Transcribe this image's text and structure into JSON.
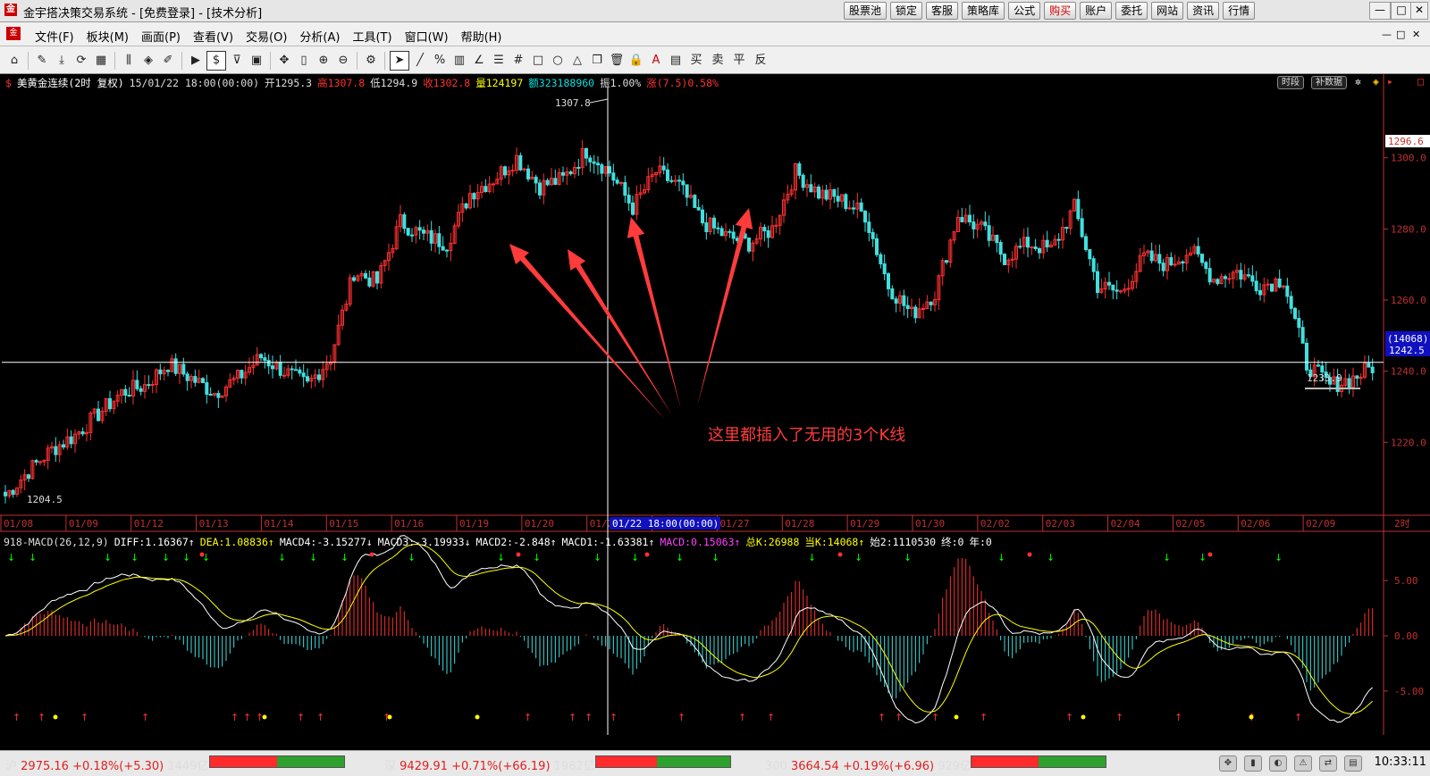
{
  "window": {
    "title": "金宇搭决策交易系统 - [免费登录] - [技术分析]",
    "top_buttons": [
      "股票池",
      "锁定",
      "客服",
      "策略库",
      "公式",
      "购买",
      "账户",
      "委托",
      "网站",
      "资讯",
      "行情"
    ],
    "controls": [
      "—",
      "□",
      "✕"
    ]
  },
  "menu": {
    "items": [
      "文件(F)",
      "板块(M)",
      "画面(P)",
      "查看(V)",
      "交易(O)",
      "分析(A)",
      "工具(T)",
      "窗口(W)",
      "帮助(H)"
    ],
    "mdi_controls": [
      "—",
      "□",
      "✕"
    ]
  },
  "toolbar": {
    "icons": [
      "home-icon",
      "pencil-icon",
      "download-icon",
      "refresh-icon",
      "grid-icon",
      "candles-icon",
      "diamond-icon",
      "edit-icon",
      "play-icon",
      "dollar-icon",
      "filter-icon",
      "calendar-icon",
      "move-icon",
      "bar-icon",
      "zoom-in-icon",
      "zoom-out-icon",
      "gear-icon",
      "pointer-icon",
      "line-tool-icon",
      "percent-icon",
      "ruler-icon",
      "angle-icon",
      "lines-icon",
      "hash-icon",
      "rect-icon",
      "circle-icon",
      "triangle-icon",
      "copy-icon",
      "trash-icon",
      "lock-icon",
      "text-color-icon",
      "box-icon"
    ],
    "text_tools": [
      "买",
      "卖",
      "平",
      "反"
    ]
  },
  "main_chart": {
    "symbol": "美黄金连续(2时 复权)",
    "datetime": "15/01/22 18:00(00:00)",
    "open": "开1295.3",
    "high": "高1307.8",
    "low": "低1294.9",
    "close": "收1302.8",
    "volume": "量124197",
    "amount": "额323188960",
    "amplitude": "振1.00%",
    "change": "涨(7.5)0.58%",
    "buttons": [
      "时段",
      "补数据"
    ],
    "high_label": "1307.8",
    "low_label": "1204.5",
    "last_label": "1233.9",
    "annotation": "这里都插入了无用的3个K线",
    "y_ticks": [
      "1300.0",
      "1280.0",
      "1260.0",
      "1240.0",
      "1220.0"
    ],
    "price_tag": "1296.6",
    "cursor_tag_top": "(14068)",
    "cursor_tag": "1242.5",
    "x_dates": [
      "01/08",
      "01/09",
      "01/12",
      "01/13",
      "01/14",
      "01/15",
      "01/16",
      "01/19",
      "01/20",
      "01/21",
      "01/22",
      "01/27",
      "01/28",
      "01/29",
      "01/30",
      "02/02",
      "02/03",
      "02/04",
      "02/05",
      "02/06",
      "02/09"
    ],
    "cursor_date": "01/22 18:00(00:00)",
    "period": "2时"
  },
  "indicator": {
    "name": "918-MACD(26,12,9)",
    "values": [
      "DIFF:1.16367↑",
      "DEA:1.08836↑",
      "MACD4:-3.15277↓",
      "MACD3:-3.19933↓",
      "MACD2:-2.848↑",
      "MACD1:-1.63381↑",
      "MACD:0.15063↑",
      "总K:26988",
      "当K:14068↑",
      "始2:1110530",
      "终:0",
      "年:0"
    ],
    "y_ticks": [
      "5.00",
      "0.00",
      "-5.00"
    ]
  },
  "chart_data": {
    "type": "candlestick",
    "title": "美黄金连续(2时 复权)",
    "ylim": [
      1200,
      1320
    ],
    "categories": [
      "01/08",
      "01/09",
      "01/12",
      "01/13",
      "01/14",
      "01/15",
      "01/16",
      "01/19",
      "01/20",
      "01/21",
      "01/22",
      "01/27",
      "01/28",
      "01/29",
      "01/30",
      "02/02",
      "02/03",
      "02/04",
      "02/05",
      "02/06",
      "02/09"
    ],
    "close_path": [
      1205,
      1212,
      1218,
      1222,
      1228,
      1234,
      1236,
      1242,
      1238,
      1234,
      1238,
      1244,
      1240,
      1236,
      1244,
      1268,
      1265,
      1282,
      1278,
      1276,
      1290,
      1294,
      1300,
      1292,
      1294,
      1302,
      1296,
      1286,
      1296,
      1292,
      1282,
      1278,
      1276,
      1280,
      1296,
      1290,
      1288,
      1284,
      1264,
      1256,
      1262,
      1284,
      1280,
      1272,
      1276,
      1274,
      1286,
      1264,
      1262,
      1272,
      1270,
      1274,
      1266,
      1268,
      1264,
      1266,
      1242,
      1236,
      1238,
      1242
    ],
    "macd": {
      "diff": 1.16367,
      "dea": 1.08836,
      "macd": 0.15063,
      "ylim": [
        -8,
        8
      ]
    }
  },
  "statusbar": {
    "sh": {
      "name": "沪",
      "price": "2975.16",
      "pct": "+0.18%",
      "chg": "(+5.30)",
      "amount": "1449亿"
    },
    "sz": {
      "name": "深",
      "price": "9429.91",
      "pct": "+0.71%",
      "chg": "(+66.19)",
      "amount": "1982亿"
    },
    "hs300": {
      "name": "300",
      "price": "3664.54",
      "pct": "+0.19%",
      "chg": "(+6.96)",
      "amount": "929亿"
    },
    "time": "10:33:11"
  }
}
